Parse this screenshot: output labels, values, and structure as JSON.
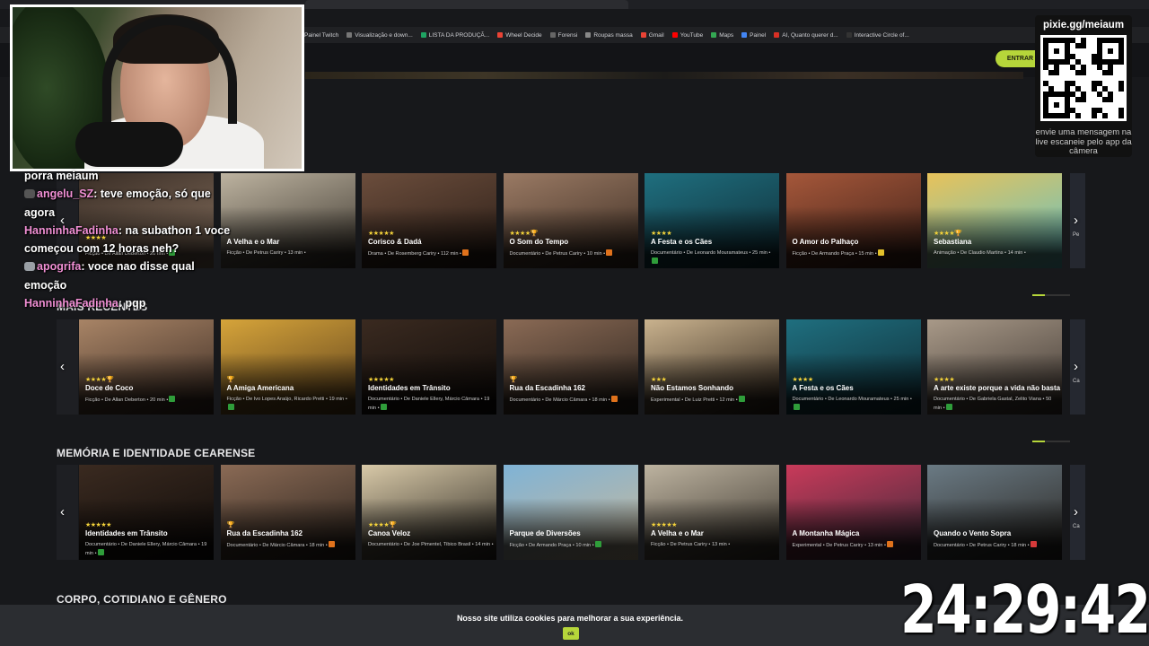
{
  "bookmarks": [
    {
      "label": "Painel Twitch",
      "color": "#9146ff"
    },
    {
      "label": "Visualização e down...",
      "color": "#777"
    },
    {
      "label": "LISTA DA PRODUÇÃ...",
      "color": "#1fa463"
    },
    {
      "label": "Wheel Decide",
      "color": "#ea4335"
    },
    {
      "label": "Forensi",
      "color": "#666"
    },
    {
      "label": "Roupas massa",
      "color": "#888"
    },
    {
      "label": "Gmail",
      "color": "#ea4335"
    },
    {
      "label": "YouTube",
      "color": "#ff0000"
    },
    {
      "label": "Maps",
      "color": "#34a853"
    },
    {
      "label": "Painel",
      "color": "#4285f4"
    },
    {
      "label": "AI, Quanto querer d...",
      "color": "#d93025"
    },
    {
      "label": "Interactive Circle of...",
      "color": "#333"
    }
  ],
  "header": {
    "enter_label": "ENTRAR"
  },
  "qr": {
    "title": "pixie.gg/meiaum",
    "note": "envie uma mensagem na live escaneie pelo app da câmera"
  },
  "chat": [
    {
      "user": "",
      "text": "porra meiaum"
    },
    {
      "user": "angelu_SZ",
      "text": "teve emoção, só que agora"
    },
    {
      "user": "HanninhaFadinha",
      "text": "na subathon 1 voce começou com 12 horas neh?"
    },
    {
      "user": "apogrifa",
      "text": "voce nao disse qual emoção"
    },
    {
      "user": "HanninhaFadinha",
      "text": "pqp"
    }
  ],
  "sections": [
    {
      "title": "",
      "cards": [
        {
          "title": "",
          "stars": "★★★★",
          "meta": "Ficção • De Allan Deberton • 20 min •",
          "badge": "green",
          "palette": [
            "#3a2e26",
            "#8a7361"
          ]
        },
        {
          "title": "A Velha e o Mar",
          "stars": "",
          "meta": "Ficção • De Petrus Cariry • 13 min •",
          "badge": "",
          "palette": [
            "#bdb3a0",
            "#3a342c"
          ]
        },
        {
          "title": "Corisco & Dadá",
          "stars": "★★★★★",
          "meta": "Drama • De Rosemberg Cariry • 112 min •",
          "badge": "orange",
          "palette": [
            "#6b4d3c",
            "#2a1d16"
          ]
        },
        {
          "title": "O Som do Tempo",
          "stars": "★★★★🏆",
          "meta": "Documentário • De Petrus Cariry • 10 min •",
          "badge": "orange",
          "palette": [
            "#9a7a64",
            "#3a2a20"
          ]
        },
        {
          "title": "A Festa e os Cães",
          "stars": "★★★★",
          "meta": "Documentário • De Leonardo Mouramateus • 25 min •",
          "badge": "green",
          "palette": [
            "#1f6f7f",
            "#0f2a33"
          ]
        },
        {
          "title": "O Amor do Palhaço",
          "stars": "",
          "meta": "Ficção • De Armando Praça • 15 min •",
          "badge": "yellow",
          "palette": [
            "#a5573a",
            "#3d2018"
          ]
        },
        {
          "title": "Sebastiana",
          "stars": "★★★★🏆",
          "meta": "Animação • De Claudio Martins • 14 min •",
          "badge": "",
          "palette": [
            "#e8c25a",
            "#5ec2c8"
          ]
        }
      ],
      "next_peek": "Pe"
    },
    {
      "title": "MAIS RECENTES",
      "cards": [
        {
          "title": "Doce de Coco",
          "stars": "★★★★🏆",
          "meta": "Ficção • De Allan Deberton • 20 min •",
          "badge": "green",
          "palette": [
            "#a88466",
            "#3a2a22"
          ]
        },
        {
          "title": "A Amiga Americana",
          "stars": "🏆",
          "meta": "Ficção • De Ivo Lopes Araújo, Ricardo Pretti • 19 min •",
          "badge": "green",
          "palette": [
            "#d6a43a",
            "#5a3e1c"
          ]
        },
        {
          "title": "Identidades em Trânsito",
          "stars": "★★★★★",
          "meta": "Documentário • De Daniele Ellery, Márcio Câmara • 19 min •",
          "badge": "green",
          "palette": [
            "#3a2a20",
            "#0f0b09"
          ]
        },
        {
          "title": "Rua da Escadinha 162",
          "stars": "🏆",
          "meta": "Documentário • De Márcio Câmara • 18 min •",
          "badge": "orange",
          "palette": [
            "#8a6a55",
            "#2a221c"
          ]
        },
        {
          "title": "Não Estamos Sonhando",
          "stars": "★★★",
          "meta": "Experimental • De Luiz Pretti • 12 min •",
          "badge": "green",
          "palette": [
            "#c9b28e",
            "#2a1f16"
          ]
        },
        {
          "title": "A Festa e os Cães",
          "stars": "★★★★",
          "meta": "Documentário • De Leonardo Mouramateus • 25 min •",
          "badge": "green",
          "palette": [
            "#1f6f7f",
            "#0f2a33"
          ]
        },
        {
          "title": "A arte existe porque a vida não basta",
          "stars": "★★★★",
          "meta": "Documentário • De Gabriela Gastal, Zelito Viana • 50 min •",
          "badge": "green",
          "palette": [
            "#a89988",
            "#3d3530"
          ]
        }
      ],
      "next_peek": "Ca"
    },
    {
      "title": "MEMÓRIA E IDENTIDADE CEARENSE",
      "cards": [
        {
          "title": "Identidades em Trânsito",
          "stars": "★★★★★",
          "meta": "Documentário • De Daniele Ellery, Márcio Câmara • 19 min •",
          "badge": "green",
          "palette": [
            "#3a2a20",
            "#0f0b09"
          ]
        },
        {
          "title": "Rua da Escadinha 162",
          "stars": "🏆",
          "meta": "Documentário • De Márcio Câmara • 18 min •",
          "badge": "orange",
          "palette": [
            "#8a6a55",
            "#2a221c"
          ]
        },
        {
          "title": "Canoa Veloz",
          "stars": "★★★★🏆",
          "meta": "Documentário • De Joe Pimentel, Tibico Brasil • 14 min •",
          "badge": "",
          "palette": [
            "#d8c9a8",
            "#2a2620"
          ]
        },
        {
          "title": "Parque de Diversões",
          "stars": "",
          "meta": "Ficção • De Armando Praça • 10 min •",
          "badge": "green",
          "palette": [
            "#7fb3d6",
            "#c9b89a"
          ]
        },
        {
          "title": "A Velha e o Mar",
          "stars": "★★★★★",
          "meta": "Ficção • De Petrus Cariry • 13 min •",
          "badge": "",
          "palette": [
            "#bdb3a0",
            "#3a342c"
          ]
        },
        {
          "title": "A Montanha Mágica",
          "stars": "",
          "meta": "Experimental • De Petrus Cariry • 13 min •",
          "badge": "orange",
          "palette": [
            "#c93a5a",
            "#3a2a3a"
          ]
        },
        {
          "title": "Quando o Vento Sopra",
          "stars": "",
          "meta": "Documentário • De Petrus Cariry • 18 min •",
          "badge": "red",
          "palette": [
            "#6a7a84",
            "#2a2622"
          ]
        }
      ],
      "next_peek": "Ca"
    },
    {
      "title": "CORPO, COTIDIANO E GÊNERO",
      "cards": []
    }
  ],
  "cookie": {
    "text": "Nosso site utiliza cookies para melhorar a sua experiência.",
    "ok_label": "ok"
  },
  "timer": "24:29:42"
}
